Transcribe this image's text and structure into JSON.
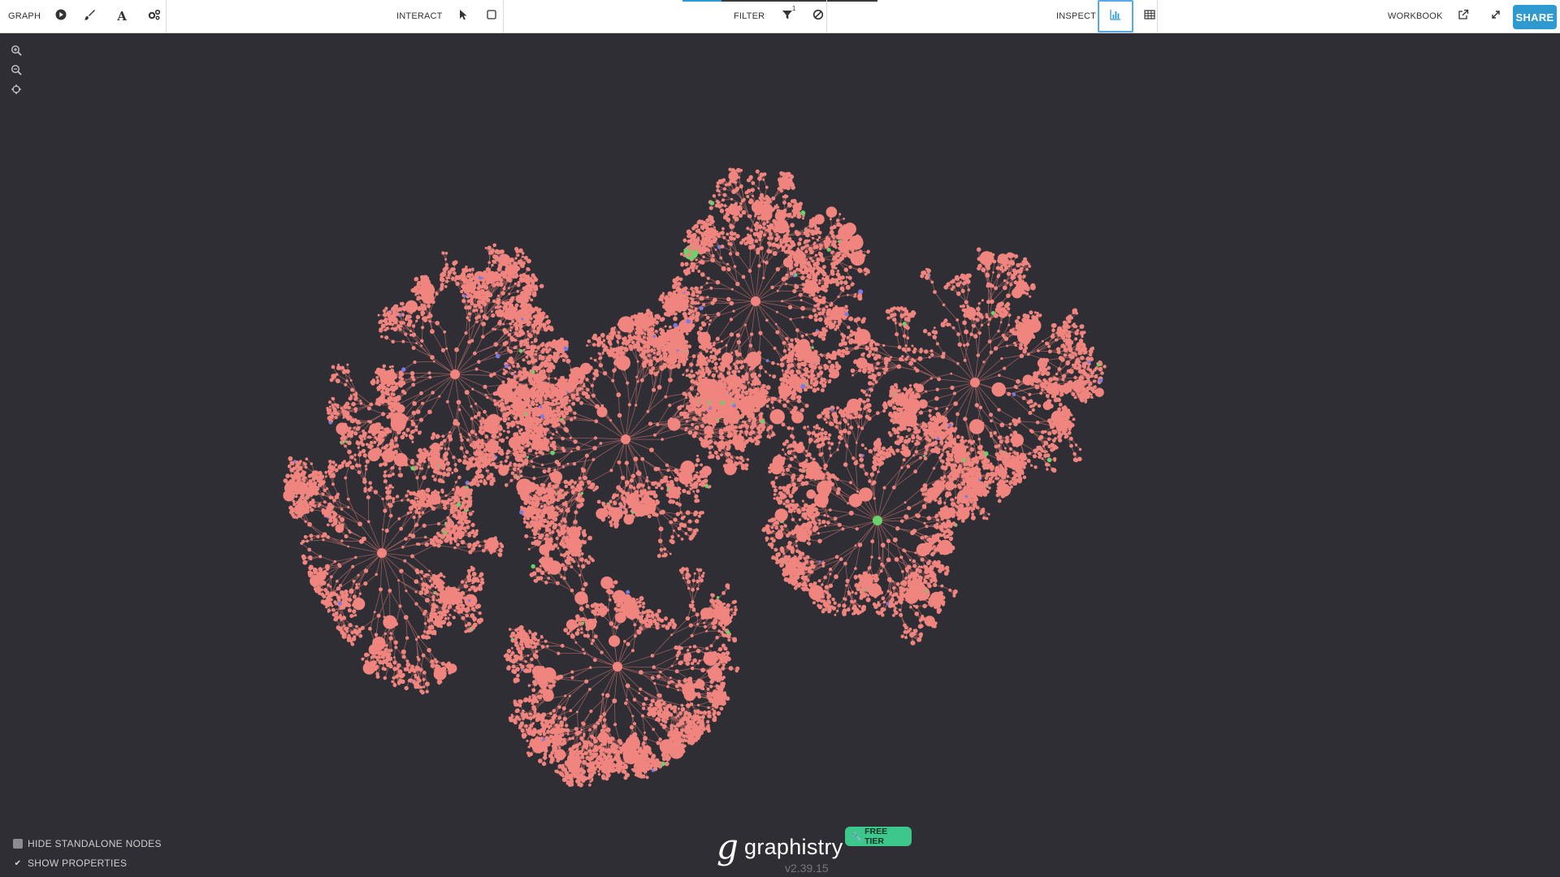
{
  "toolbar": {
    "graph": {
      "label": "GRAPH"
    },
    "interact": {
      "label": "INTERACT"
    },
    "filter": {
      "label": "FILTER",
      "badge": "1"
    },
    "inspect": {
      "label": "INSPECT"
    },
    "workbook": {
      "label": "WORKBOOK"
    },
    "share_label": "SHARE",
    "progress_fraction": 0.2
  },
  "icons": {
    "play": "play-icon",
    "brush": "brush-icon",
    "text": "text-icon",
    "settings": "cogs-icon",
    "pointer": "pointer-icon",
    "select_box": "select-box-icon",
    "filter": "filter-icon",
    "exclude": "exclude-icon",
    "histogram": "histogram-icon",
    "table": "table-icon",
    "external": "external-link-icon",
    "fullscreen": "fullscreen-icon",
    "zoom_in": "zoom-in-icon",
    "zoom_out": "zoom-out-icon",
    "center": "center-icon"
  },
  "graph": {
    "node_color": "#f0847e",
    "accent_colors": [
      "#6ad26a",
      "#7a7ae6"
    ],
    "background": "#2e2e34"
  },
  "options": {
    "hide_standalone": {
      "label": "HIDE STANDALONE NODES",
      "checked": false
    },
    "show_properties": {
      "label": "SHOW PROPERTIES",
      "checked": true
    }
  },
  "logo": {
    "g": "g",
    "wordmark": "graphistry",
    "version": "v2.39.15",
    "badge": "FREE TIER"
  }
}
